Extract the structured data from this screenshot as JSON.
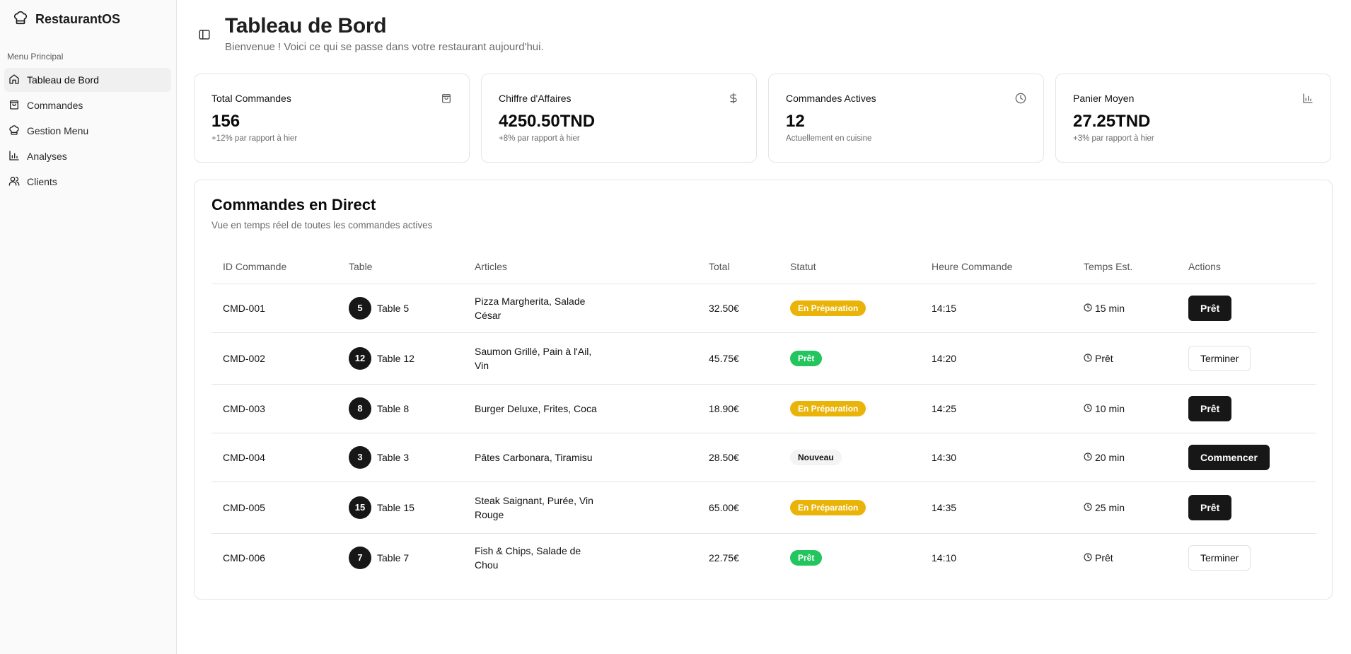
{
  "app": {
    "name": "RestaurantOS"
  },
  "sidebar": {
    "section_label": "Menu Principal",
    "items": [
      {
        "label": "Tableau de Bord",
        "icon": "home-icon",
        "active": true
      },
      {
        "label": "Commandes",
        "icon": "shopping-bag-icon"
      },
      {
        "label": "Gestion Menu",
        "icon": "chef-hat-icon"
      },
      {
        "label": "Analyses",
        "icon": "bar-chart-icon"
      },
      {
        "label": "Clients",
        "icon": "users-icon"
      }
    ]
  },
  "header": {
    "title": "Tableau de Bord",
    "subtitle": "Bienvenue ! Voici ce qui se passe dans votre restaurant aujourd'hui."
  },
  "stats": [
    {
      "title": "Total Commandes",
      "value": "156",
      "note": "+12% par rapport à hier",
      "icon": "shopping-bag-icon"
    },
    {
      "title": "Chiffre d'Affaires",
      "value": "4250.50TND",
      "note": "+8% par rapport à hier",
      "icon": "dollar-icon"
    },
    {
      "title": "Commandes Actives",
      "value": "12",
      "note": "Actuellement en cuisine",
      "icon": "clock-icon"
    },
    {
      "title": "Panier Moyen",
      "value": "27.25TND",
      "note": "+3% par rapport à hier",
      "icon": "bar-chart-icon"
    }
  ],
  "orders": {
    "title": "Commandes en Direct",
    "subtitle": "Vue en temps réel de toutes les commandes actives",
    "columns": [
      "ID Commande",
      "Table",
      "Articles",
      "Total",
      "Statut",
      "Heure Commande",
      "Temps Est.",
      "Actions"
    ],
    "rows": [
      {
        "id": "CMD-001",
        "table_num": "5",
        "table": "Table 5",
        "articles": "Pizza Margherita, Salade César",
        "total": "32.50€",
        "status": "En Préparation",
        "status_kind": "prep",
        "time": "14:15",
        "est": "15 min",
        "action": "Prêt",
        "action_kind": "dark"
      },
      {
        "id": "CMD-002",
        "table_num": "12",
        "table": "Table 12",
        "articles": "Saumon Grillé, Pain à l'Ail, Vin",
        "total": "45.75€",
        "status": "Prêt",
        "status_kind": "pret",
        "time": "14:20",
        "est": "Prêt",
        "action": "Terminer",
        "action_kind": "light"
      },
      {
        "id": "CMD-003",
        "table_num": "8",
        "table": "Table 8",
        "articles": "Burger Deluxe, Frites, Coca",
        "total": "18.90€",
        "status": "En Préparation",
        "status_kind": "prep",
        "time": "14:25",
        "est": "10 min",
        "action": "Prêt",
        "action_kind": "dark"
      },
      {
        "id": "CMD-004",
        "table_num": "3",
        "table": "Table 3",
        "articles": "Pâtes Carbonara, Tiramisu",
        "total": "28.50€",
        "status": "Nouveau",
        "status_kind": "new",
        "time": "14:30",
        "est": "20 min",
        "action": "Commencer",
        "action_kind": "dark"
      },
      {
        "id": "CMD-005",
        "table_num": "15",
        "table": "Table 15",
        "articles": "Steak Saignant, Purée, Vin Rouge",
        "total": "65.00€",
        "status": "En Préparation",
        "status_kind": "prep",
        "time": "14:35",
        "est": "25 min",
        "action": "Prêt",
        "action_kind": "dark"
      },
      {
        "id": "CMD-006",
        "table_num": "7",
        "table": "Table 7",
        "articles": "Fish & Chips, Salade de Chou",
        "total": "22.75€",
        "status": "Prêt",
        "status_kind": "pret",
        "time": "14:10",
        "est": "Prêt",
        "action": "Terminer",
        "action_kind": "light"
      }
    ]
  }
}
